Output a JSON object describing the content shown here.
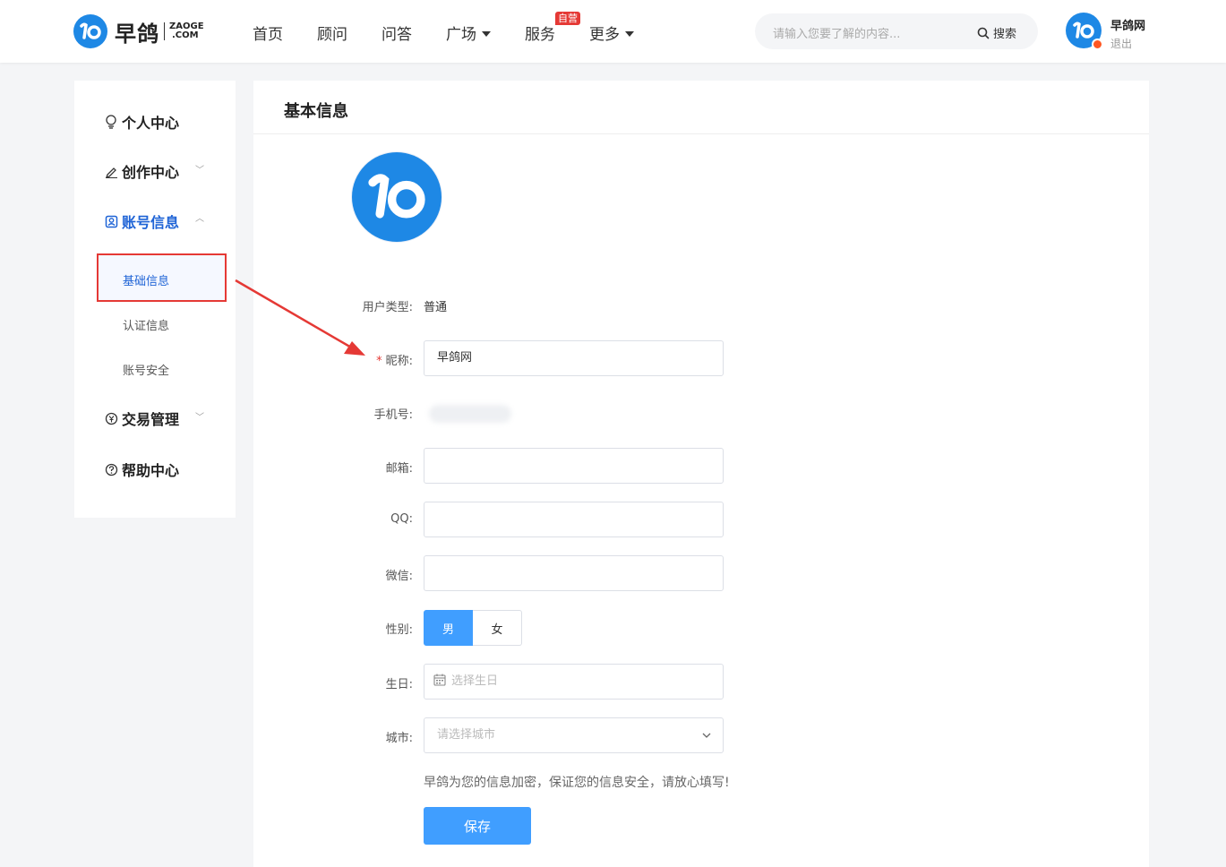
{
  "header": {
    "logo_cn": "早鸽",
    "logo_en_top": "ZAOGE",
    "logo_en_bottom": ".COM",
    "nav": [
      {
        "label": "首页"
      },
      {
        "label": "顾问"
      },
      {
        "label": "问答"
      },
      {
        "label": "广场"
      },
      {
        "label": "服务",
        "badge": "自营"
      },
      {
        "label": "更多"
      }
    ],
    "search": {
      "placeholder": "请输入您要了解的内容...",
      "button": "搜索"
    },
    "user": {
      "name": "早鸽网",
      "logout": "退出"
    }
  },
  "sidebar": {
    "items": [
      {
        "label": "个人中心",
        "icon": "bulb-icon"
      },
      {
        "label": "创作中心",
        "icon": "pen-icon"
      },
      {
        "label": "账号信息",
        "icon": "account-icon"
      },
      {
        "label": "交易管理",
        "icon": "yen-icon"
      },
      {
        "label": "帮助中心",
        "icon": "question-icon"
      }
    ],
    "sub_items": [
      {
        "label": "基础信息"
      },
      {
        "label": "认证信息"
      },
      {
        "label": "账号安全"
      }
    ]
  },
  "main": {
    "title": "基本信息",
    "fields": {
      "user_type_label": "用户类型:",
      "user_type_value": "普通",
      "nickname_label": "昵称:",
      "nickname_value": "早鸽网",
      "phone_label": "手机号:",
      "email_label": "邮箱:",
      "email_value": "",
      "qq_label": "QQ:",
      "qq_value": "",
      "wechat_label": "微信:",
      "wechat_value": "",
      "gender_label": "性别:",
      "gender_male": "男",
      "gender_female": "女",
      "birthday_label": "生日:",
      "birthday_placeholder": "选择生日",
      "city_label": "城市:",
      "city_placeholder": "请选择城市"
    },
    "note": "早鸽为您的信息加密，保证您的信息安全，请放心填写!",
    "save": "保存"
  },
  "colors": {
    "brand": "#1e88e5",
    "primary_button": "#409eff",
    "active_text": "#1e63d6",
    "highlight": "#e53935"
  }
}
